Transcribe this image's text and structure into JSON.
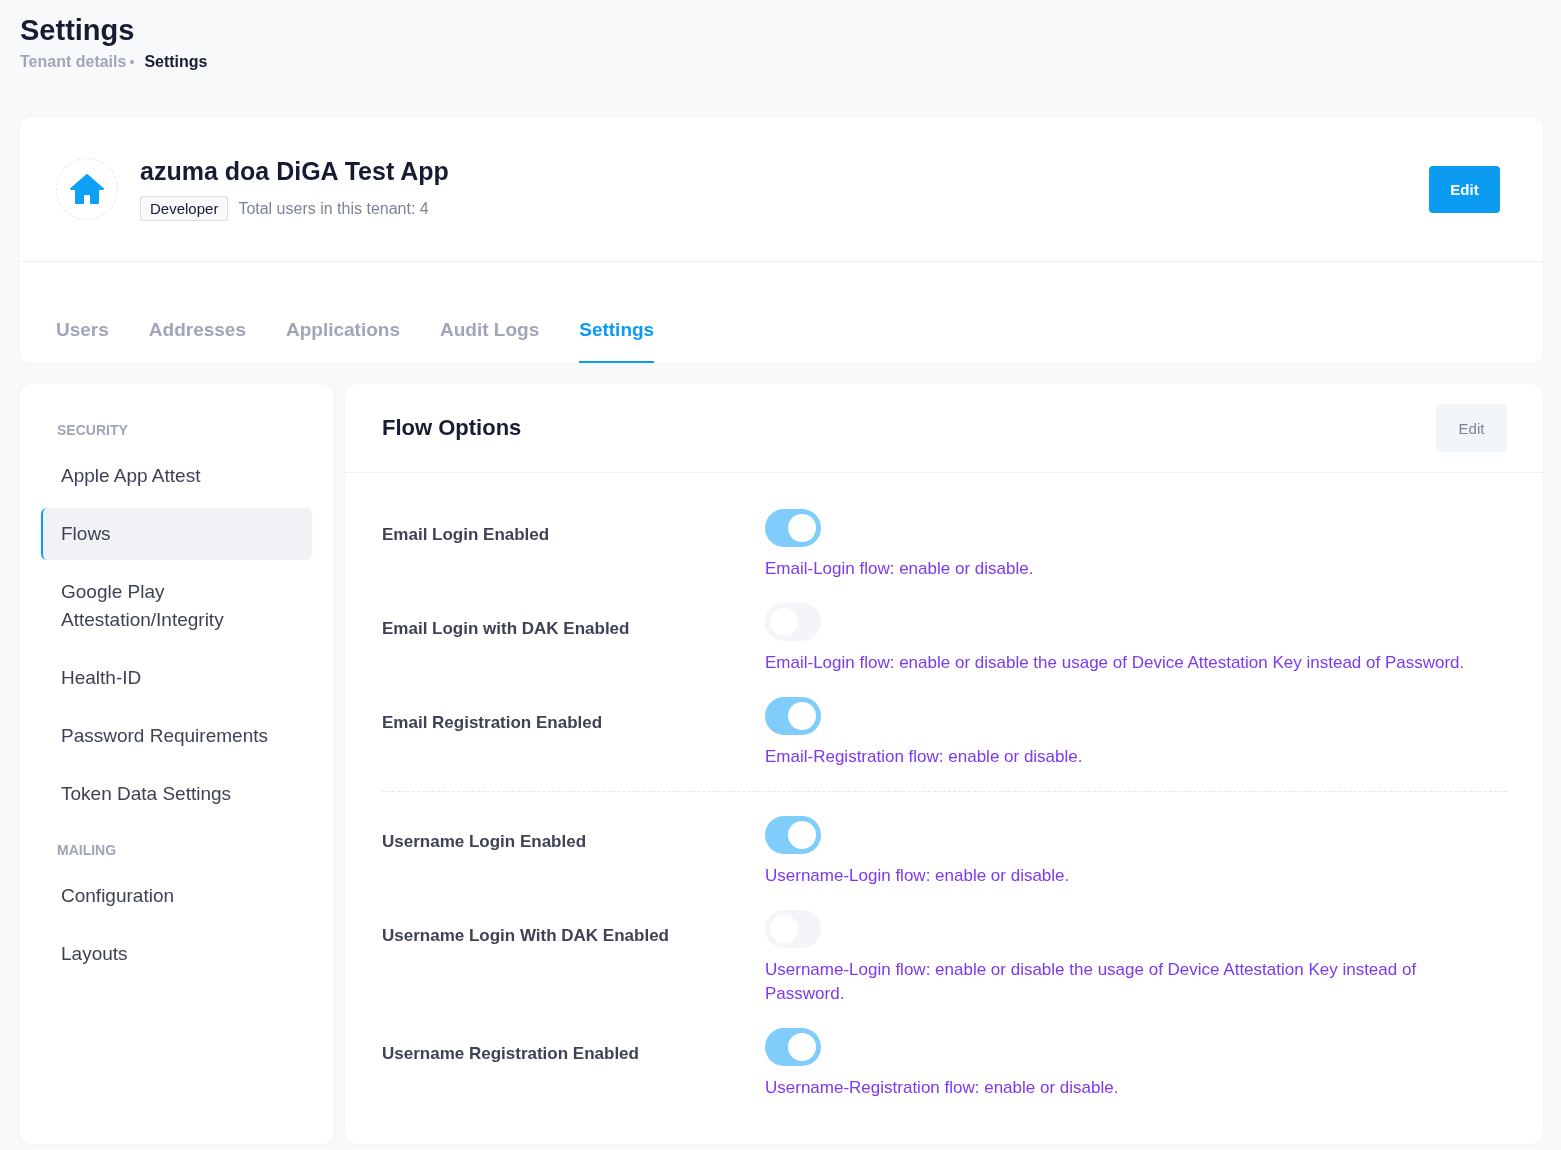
{
  "page": {
    "title": "Settings",
    "breadcrumb": [
      {
        "label": "Tenant details",
        "current": false
      },
      {
        "label": "Settings",
        "current": true
      }
    ]
  },
  "tenant": {
    "name": "azuma doa DiGA Test App",
    "role": "Developer",
    "users": "Total users in this tenant: 4",
    "edit_button": "Edit"
  },
  "tabs": [
    {
      "label": "Users",
      "selected": false
    },
    {
      "label": "Addresses",
      "selected": false
    },
    {
      "label": "Applications",
      "selected": false
    },
    {
      "label": "Audit Logs",
      "selected": false
    },
    {
      "label": "Settings",
      "selected": true
    }
  ],
  "sidebar": {
    "sections": [
      {
        "heading": "SECURITY",
        "items": [
          {
            "label": "Apple App Attest",
            "selected": false
          },
          {
            "label": "Flows",
            "selected": true
          },
          {
            "label": "Google Play Attestation/Integrity",
            "selected": false
          },
          {
            "label": "Health-ID",
            "selected": false
          },
          {
            "label": "Password Requirements",
            "selected": false
          },
          {
            "label": "Token Data Settings",
            "selected": false
          }
        ]
      },
      {
        "heading": "MAILING",
        "items": [
          {
            "label": "Configuration",
            "selected": false
          },
          {
            "label": "Layouts",
            "selected": false
          }
        ]
      }
    ]
  },
  "flow_options": {
    "title": "Flow Options",
    "edit_button": "Edit",
    "groups": [
      [
        {
          "label": "Email Login Enabled",
          "on": true,
          "description": "Email-Login flow: enable or disable."
        },
        {
          "label": "Email Login with DAK Enabled",
          "on": false,
          "description": "Email-Login flow: enable or disable the usage of Device Attestation Key instead of Password."
        },
        {
          "label": "Email Registration Enabled",
          "on": true,
          "description": "Email-Registration flow: enable or disable."
        }
      ],
      [
        {
          "label": "Username Login Enabled",
          "on": true,
          "description": "Username-Login flow: enable or disable."
        },
        {
          "label": "Username Login With DAK Enabled",
          "on": false,
          "description": "Username-Login flow: enable or disable the usage of Device Attestation Key instead of Password."
        },
        {
          "label": "Username Registration Enabled",
          "on": true,
          "description": "Username-Registration flow: enable or disable."
        }
      ]
    ]
  }
}
